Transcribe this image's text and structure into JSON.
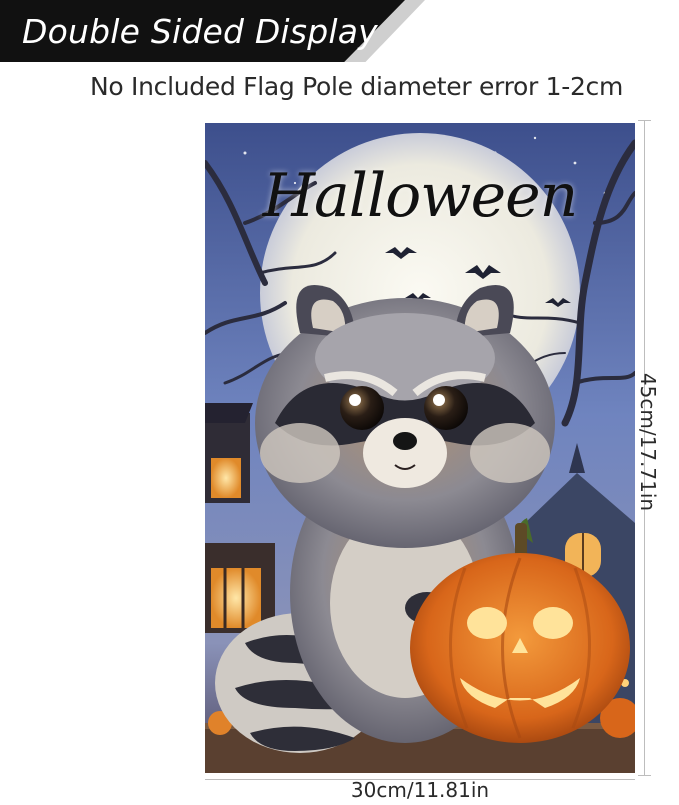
{
  "banner": {
    "text": "Double Sided Display"
  },
  "subtitle": "No Included Flag Pole diameter error 1-2cm",
  "flag": {
    "title": "Halloween",
    "subject": "raccoon-with-jack-o-lantern",
    "colors": {
      "sky": "#5b6ea8",
      "moon": "#f2f1ea",
      "pumpkin": "#e07a22",
      "glow": "#ffd27a",
      "fur_dark": "#3a3a46",
      "fur_light": "#d9d2c8",
      "floor": "#5a4030"
    }
  },
  "dimensions": {
    "height_label": "45cm/17.71in",
    "width_label": "30cm/11.81in"
  }
}
